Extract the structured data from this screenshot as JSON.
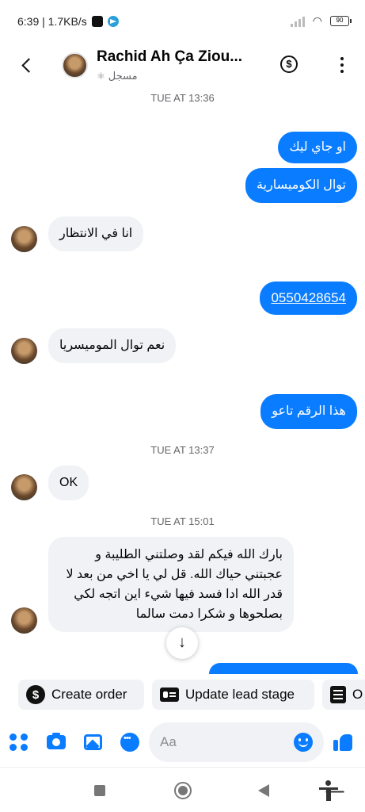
{
  "status_bar": {
    "time_speed": "6:39 | 1.7KB/s",
    "battery": "90"
  },
  "header": {
    "contact_name": "Rachid Ah Ça Ziou...",
    "contact_status": "مسجل",
    "icons": [
      "back-icon",
      "dollar-icon",
      "more-icon"
    ]
  },
  "timestamps": {
    "t1": "TUE AT 13:36",
    "t2": "TUE AT 13:37",
    "t3": "TUE AT 15:01"
  },
  "messages": {
    "m1": "او جاي ليك",
    "m2": "توال الكوميسارية",
    "m3": "انا في الانتظار",
    "m4": "0550428654",
    "m5": "نعم توال الموميسريا",
    "m6": "هذا الرقم تاعو",
    "m7": "OK",
    "m8_l1": "بارك الله فيكم لقد وصلتني الطليبة و",
    "m8_l2": "عجبتني حياك الله. قل لي يا اخي من بعد لا",
    "m8_l3": "قدر الله ادا فسد فيها شيء اين اتجه لكي",
    "m8_l4": "بصلحوها و شكرا دمت سالما"
  },
  "actions": {
    "create_order": "Create order",
    "update_lead": "Update lead stage",
    "third": "O"
  },
  "composer": {
    "placeholder": "Aa"
  },
  "colors": {
    "outgoing": "#0a7cff",
    "incoming": "#f0f2f5"
  }
}
